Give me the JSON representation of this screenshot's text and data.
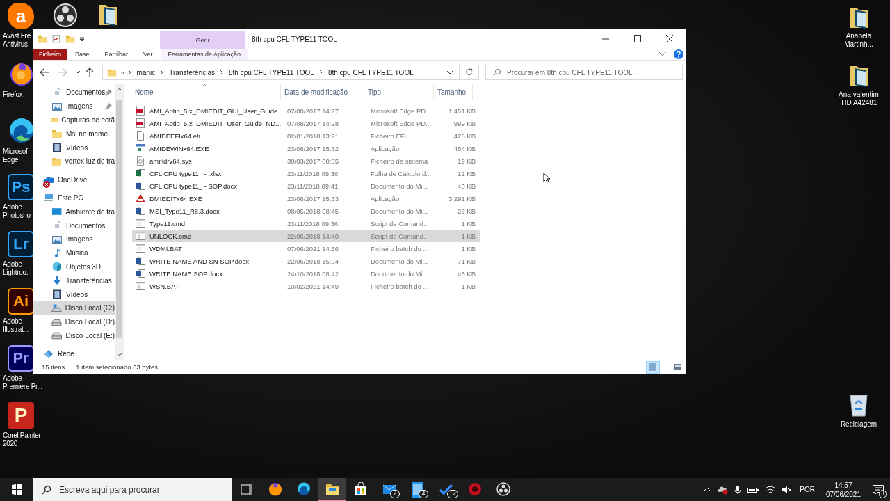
{
  "desktop": {
    "left_icons": [
      {
        "kind": "avast",
        "glyph": "a",
        "label": "Avast Fre\nAntivirus"
      },
      {
        "kind": "firefox",
        "label": "Firefox"
      },
      {
        "kind": "edge",
        "label": "Microsof\nEdge"
      },
      {
        "kind": "ps",
        "glyph": "Ps",
        "label": "Adobe\nPhotosho"
      },
      {
        "kind": "lr",
        "glyph": "Lr",
        "label": "Adobe\nLightroo."
      },
      {
        "kind": "ai",
        "glyph": "Ai",
        "label": "Adobe\nIllustrat..."
      },
      {
        "kind": "pr",
        "glyph": "Pr",
        "label": "Adobe\nPremiere Pr..."
      },
      {
        "kind": "corel",
        "glyph": "P",
        "label": "Corel Painter\n2020"
      }
    ],
    "top_icons": [
      {
        "kind": "obs"
      },
      {
        "kind": "psfolder"
      }
    ],
    "right_icons": [
      {
        "kind": "psfolder",
        "label": "Anabela\nMartinh..."
      },
      {
        "kind": "psfolder",
        "label": "Ana valentim\nTID A42481"
      },
      {
        "kind": "recycle",
        "label": "Reciclagem"
      }
    ]
  },
  "window": {
    "title": "8th cpu CFL TYPE11 TOOL",
    "context_group": "Gerir",
    "tabs": [
      {
        "label": "Ficheiro",
        "kind": "file"
      },
      {
        "label": "Base",
        "kind": "normal"
      },
      {
        "label": "Partilhar",
        "kind": "normal"
      },
      {
        "label": "Ver",
        "kind": "normal"
      },
      {
        "label": "Ferramentas de Aplicação",
        "kind": "context"
      }
    ],
    "address": {
      "overflow": "«",
      "crumbs": [
        "manic",
        "Transferências",
        "8th cpu CFL TYPE11 TOOL",
        "8th cpu CFL TYPE11 TOOL"
      ]
    },
    "search": {
      "placeholder": "Procurar em 8th cpu CFL TYPE11 TOOL"
    },
    "nav": {
      "quick_items": [
        {
          "label": "Documentos",
          "kind": "doc",
          "pinned": true,
          "selected": false
        },
        {
          "label": "Imagens",
          "kind": "pics",
          "pinned": true,
          "selected": false
        },
        {
          "label": "Capturas de ecrã",
          "kind": "folder",
          "pinned": false,
          "selected": false
        },
        {
          "label": "Msi no mame",
          "kind": "folder",
          "pinned": false,
          "selected": false
        },
        {
          "label": "Vídeos",
          "kind": "video",
          "pinned": false,
          "selected": false
        },
        {
          "label": "vortex luz de tra",
          "kind": "folder",
          "pinned": false,
          "selected": false
        }
      ],
      "tree": [
        {
          "label": "OneDrive",
          "kind": "onedrive",
          "error": true,
          "selected": false
        },
        {
          "label": "Este PC",
          "kind": "pc",
          "selected": false,
          "children": [
            {
              "label": "Ambiente de tra",
              "kind": "desktop",
              "selected": false
            },
            {
              "label": "Documentos",
              "kind": "doc",
              "selected": false
            },
            {
              "label": "Imagens",
              "kind": "pics",
              "selected": false
            },
            {
              "label": "Música",
              "kind": "music",
              "selected": false
            },
            {
              "label": "Objetos 3D",
              "kind": "cube",
              "selected": false
            },
            {
              "label": "Transferências",
              "kind": "download",
              "selected": false
            },
            {
              "label": "Vídeos",
              "kind": "video",
              "selected": false
            },
            {
              "label": "Disco Local (C:)",
              "kind": "sysdrive",
              "selected": true
            },
            {
              "label": "Disco Local (D:)",
              "kind": "drive",
              "selected": false
            },
            {
              "label": "Disco Local (E:)",
              "kind": "drive",
              "selected": false
            }
          ]
        },
        {
          "label": "Rede",
          "kind": "network",
          "selected": false
        }
      ]
    },
    "columns": [
      "Nome",
      "Data de modificação",
      "Tipo",
      "Tamanho"
    ],
    "files": [
      {
        "name": "AMI_Aptio_5.x_DMIEDIT_GUI_User_Guide...",
        "date": "07/08/2017 14:27",
        "type": "Microsoft Edge PD...",
        "size": "1 451 KB",
        "kind": "pdf",
        "selected": false
      },
      {
        "name": "AMI_Aptio_5.x_DMIEDIT_User_Guide_ND...",
        "date": "07/08/2017 14:28",
        "type": "Microsoft Edge PD...",
        "size": "999 KB",
        "kind": "pdf",
        "selected": false
      },
      {
        "name": "AMIDEEFIx64.efi",
        "date": "02/01/2018 13:21",
        "type": "Ficheiro EFI",
        "size": "425 KB",
        "kind": "blank",
        "selected": false
      },
      {
        "name": "AMIDEWINx64.EXE",
        "date": "23/08/2017 15:32",
        "type": "Aplicação",
        "size": "454 KB",
        "kind": "app",
        "selected": false
      },
      {
        "name": "amifldrv64.sys",
        "date": "30/03/2017 00:05",
        "type": "Ficheiro de sistema",
        "size": "19 KB",
        "kind": "sys",
        "selected": false
      },
      {
        "name": "CFL CPU type11_ - .xlsx",
        "date": "23/11/2018 09:36",
        "type": "Folha de Cálculo d...",
        "size": "12 KB",
        "kind": "excel",
        "selected": false
      },
      {
        "name": "CFL CPU type11_ - SOP.docx",
        "date": "23/11/2018 09:41",
        "type": "Documento do Mi...",
        "size": "40 KB",
        "kind": "word",
        "selected": false
      },
      {
        "name": "DMIEDITx64.EXE",
        "date": "23/08/2017 15:33",
        "type": "Aplicação",
        "size": "3 291 KB",
        "kind": "redapp",
        "selected": false
      },
      {
        "name": "MSI_Type11_R8.3.docx",
        "date": "08/05/2018 08:45",
        "type": "Documento do Mi...",
        "size": "23 KB",
        "kind": "word",
        "selected": false
      },
      {
        "name": "Type11.cmd",
        "date": "23/11/2018 09:36",
        "type": "Script de Comand...",
        "size": "1 KB",
        "kind": "script",
        "selected": false
      },
      {
        "name": "UNLOCK.cmd",
        "date": "22/06/2018 14:40",
        "type": "Script de Comand...",
        "size": "1 KB",
        "kind": "script",
        "selected": true
      },
      {
        "name": "WDMI.BAT",
        "date": "07/06/2021 14:56",
        "type": "Ficheiro batch do ...",
        "size": "1 KB",
        "kind": "script",
        "selected": false
      },
      {
        "name": "WRITE NAME AND SN SOP.docx",
        "date": "22/06/2018 15:04",
        "type": "Documento do Mi...",
        "size": "71 KB",
        "kind": "word",
        "selected": false
      },
      {
        "name": "WRITE NAME SOP.docx",
        "date": "24/10/2018 08:42",
        "type": "Documento do Mi...",
        "size": "45 KB",
        "kind": "word",
        "selected": false
      },
      {
        "name": "WSN.BAT",
        "date": "10/02/2021 14:49",
        "type": "Ficheiro batch do ...",
        "size": "1 KB",
        "kind": "script",
        "selected": false
      }
    ],
    "status": {
      "count": "15 itens",
      "selection": "1 item selecionado 63 bytes"
    },
    "views": [
      {
        "kind": "details",
        "selected": true
      },
      {
        "kind": "tiles",
        "selected": false
      }
    ]
  },
  "taskbar": {
    "search": {
      "placeholder": "Escreva aqui para procurar"
    },
    "apps": [
      {
        "kind": "taskview",
        "active": false
      },
      {
        "kind": "firefox",
        "active": false
      },
      {
        "kind": "edge",
        "active": false
      },
      {
        "kind": "explorer",
        "active": true
      },
      {
        "kind": "store",
        "active": false
      },
      {
        "kind": "mail",
        "badge": "2",
        "active": false
      },
      {
        "kind": "phone",
        "badge": "4",
        "active": false
      },
      {
        "kind": "todo",
        "badge": "12",
        "active": false
      },
      {
        "kind": "redapp",
        "active": false
      },
      {
        "kind": "obs",
        "active": false
      }
    ],
    "language": "POR",
    "time": "14:57",
    "date": "07/06/2021",
    "notifications": "3"
  }
}
